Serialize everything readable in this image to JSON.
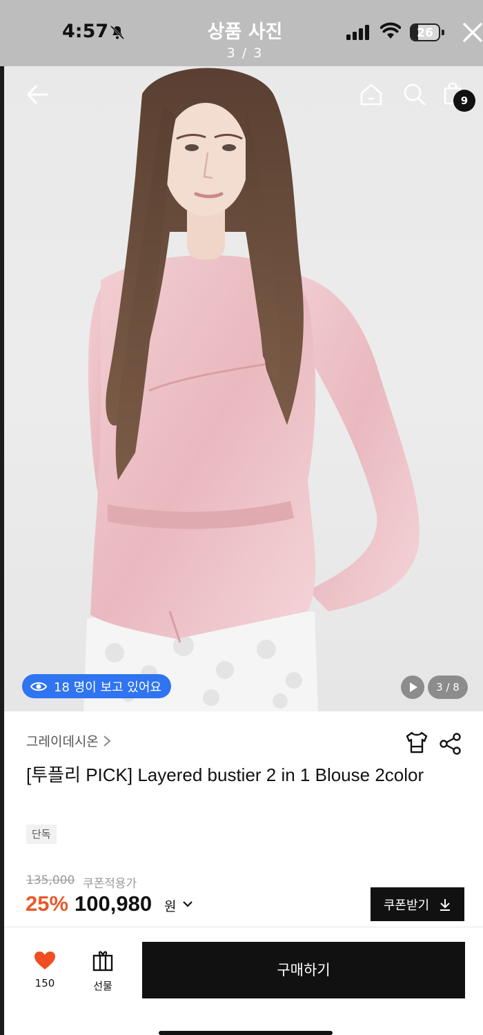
{
  "status_bar": {
    "time": "4:57",
    "battery": "26"
  },
  "viewer": {
    "title": "상품 사진",
    "counter": "3 / 3"
  },
  "header": {
    "bag_count": "9"
  },
  "photo": {
    "viewers_text": "18 명이 보고 있어요",
    "image_counter": "3 / 8"
  },
  "product": {
    "brand": "그레이데시온",
    "title": "[투플리 PICK] Layered bustier 2 in 1 Blouse 2color",
    "tag": "단독"
  },
  "price": {
    "original": "135,000",
    "label": "쿠폰적용가",
    "discount": "25%",
    "final": "100,980",
    "unit": "원"
  },
  "coupon": {
    "label": "쿠폰받기"
  },
  "bottom_bar": {
    "like_count": "150",
    "gift_label": "선물",
    "buy_label": "구매하기"
  },
  "colors": {
    "accent_blue": "#2f74f0",
    "discount_orange": "#e85a2a",
    "heart_red": "#ef4e22"
  }
}
